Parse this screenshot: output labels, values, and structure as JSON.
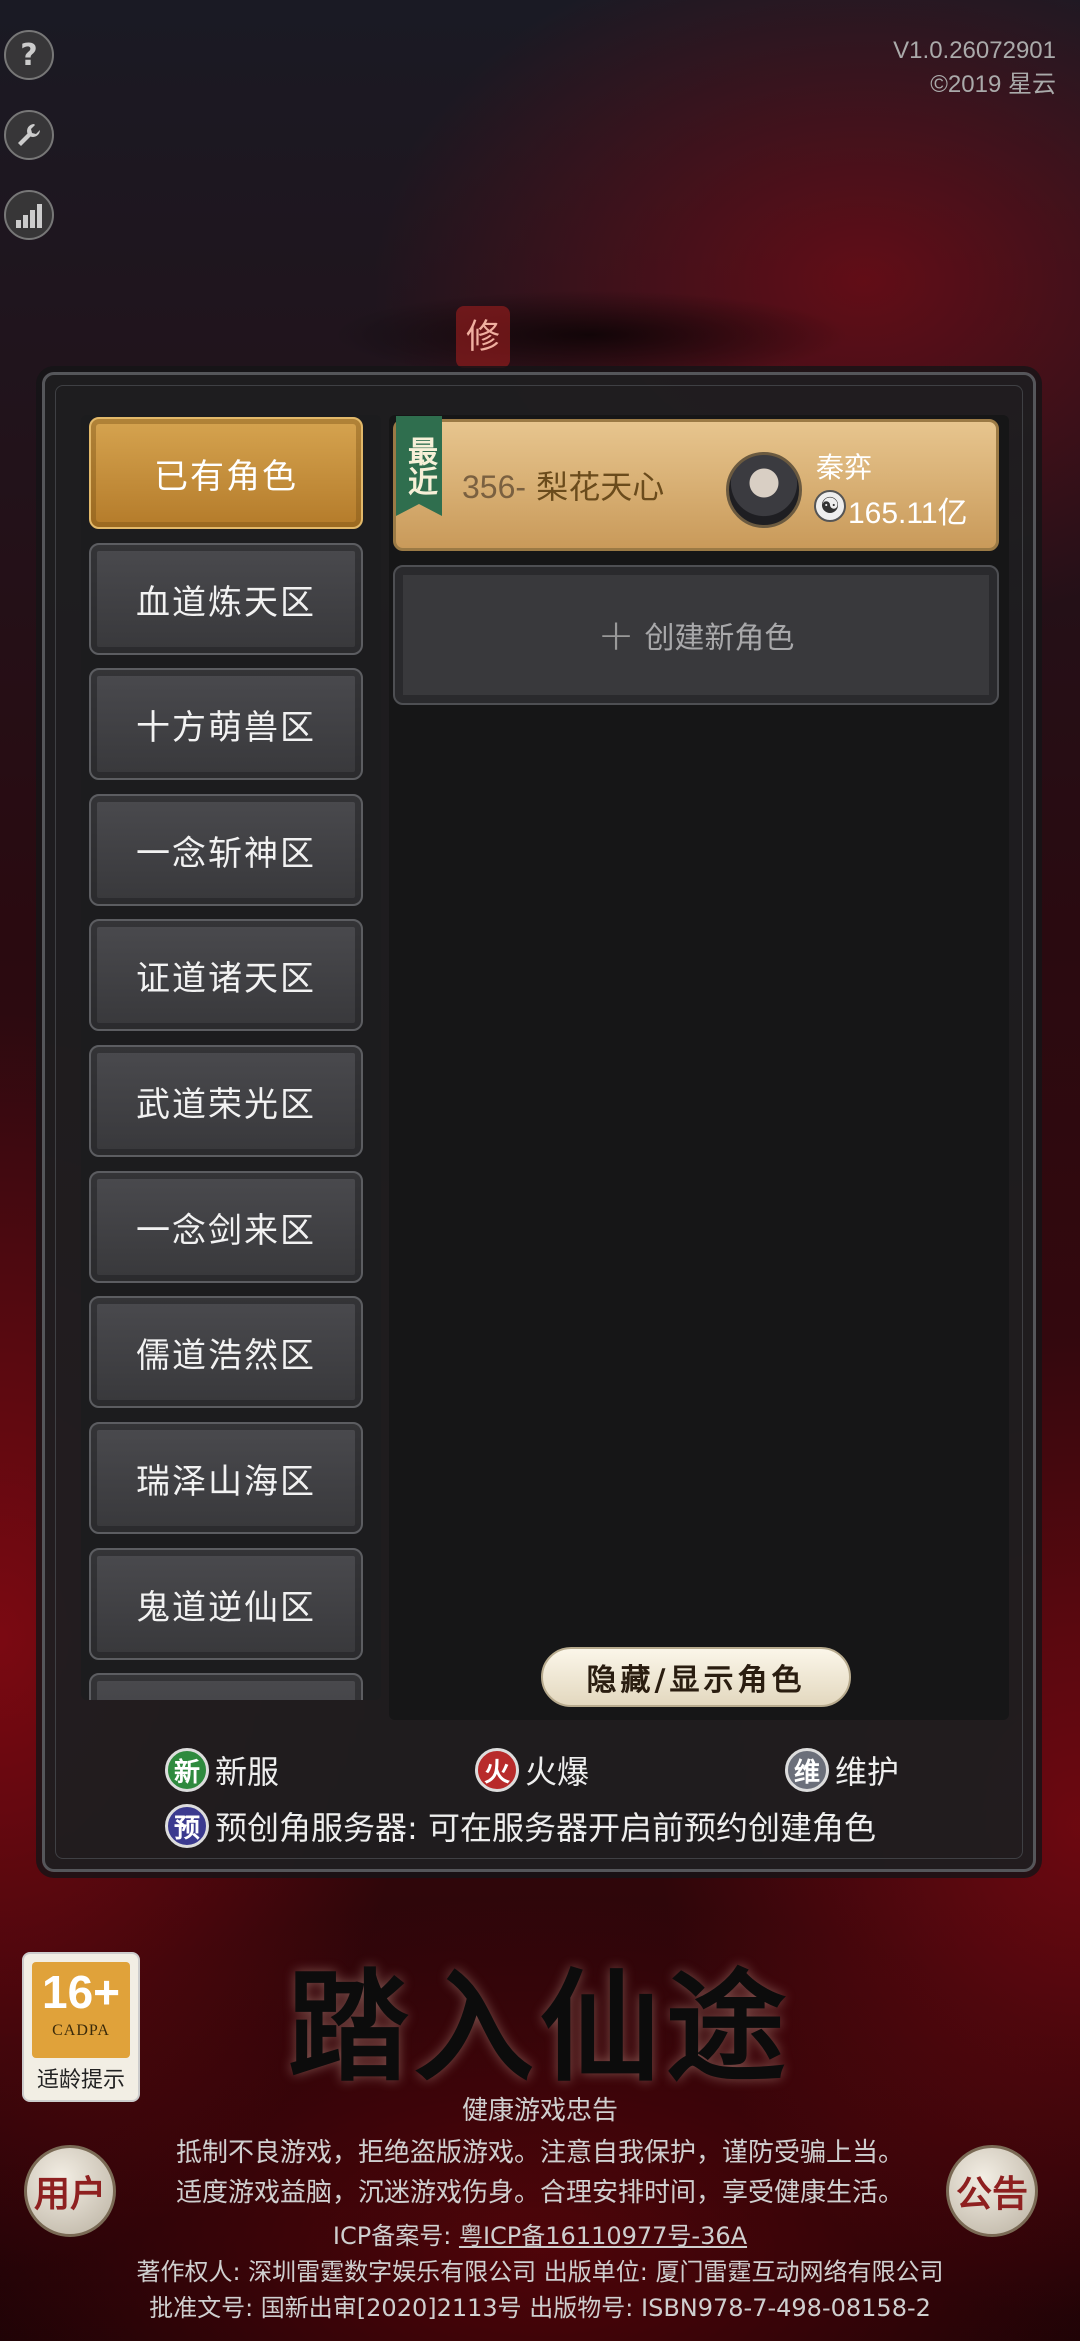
{
  "app": {
    "version": "V1.0.26072901",
    "copyright": "©2019 星云",
    "side_icons": [
      {
        "name": "help-icon",
        "glyph": "?"
      },
      {
        "name": "wrench-icon",
        "glyph": "🔧"
      },
      {
        "name": "signal-icon",
        "glyph": "📶"
      }
    ]
  },
  "servers": {
    "items": [
      {
        "label": "已有角色",
        "active": true
      },
      {
        "label": "血道炼天区"
      },
      {
        "label": "十方萌兽区"
      },
      {
        "label": "一念斩神区"
      },
      {
        "label": "证道诸天区"
      },
      {
        "label": "武道荣光区"
      },
      {
        "label": "一念剑来区"
      },
      {
        "label": "儒道浩然区"
      },
      {
        "label": "瑞泽山海区"
      },
      {
        "label": "鬼道逆仙区"
      }
    ]
  },
  "roles": {
    "recent_tag": "最近",
    "recent": {
      "server_num": "356-",
      "server_name": "梨花天心",
      "name": "秦弈",
      "power": "165.11亿"
    },
    "create_label": "创建新角色",
    "toggle_label": "隐藏/显示角色"
  },
  "legend": {
    "new_badge": "新",
    "new_label": "新服",
    "hot_badge": "火",
    "hot_label": "火爆",
    "maint_badge": "维",
    "maint_label": "维护",
    "pre_badge": "预",
    "pre_label": "预创角服务器: 可在服务器开启前预约创建角色"
  },
  "bottom": {
    "age_num": "16+",
    "age_org": "CADPA",
    "age_tip": "适龄提示",
    "title": "踏入仙途",
    "user_btn": "用户",
    "notice_btn": "公告",
    "health_title": "健康游戏忠告",
    "health_line1": "抵制不良游戏，拒绝盗版游戏。注意自我保护，谨防受骗上当。",
    "health_line2": "适度游戏益脑，沉迷游戏伤身。合理安排时间，享受健康生活。",
    "icp_label": "ICP备案号:",
    "icp_value": "粤ICP备16110977号-36A",
    "copyright_line": "著作权人: 深圳雷霆数字娱乐有限公司 出版单位: 厦门雷霆互动网络有限公司",
    "approval_line": "批准文号: 国新出审[2020]2113号 出版物号: ISBN978-7-498-08158-2"
  }
}
